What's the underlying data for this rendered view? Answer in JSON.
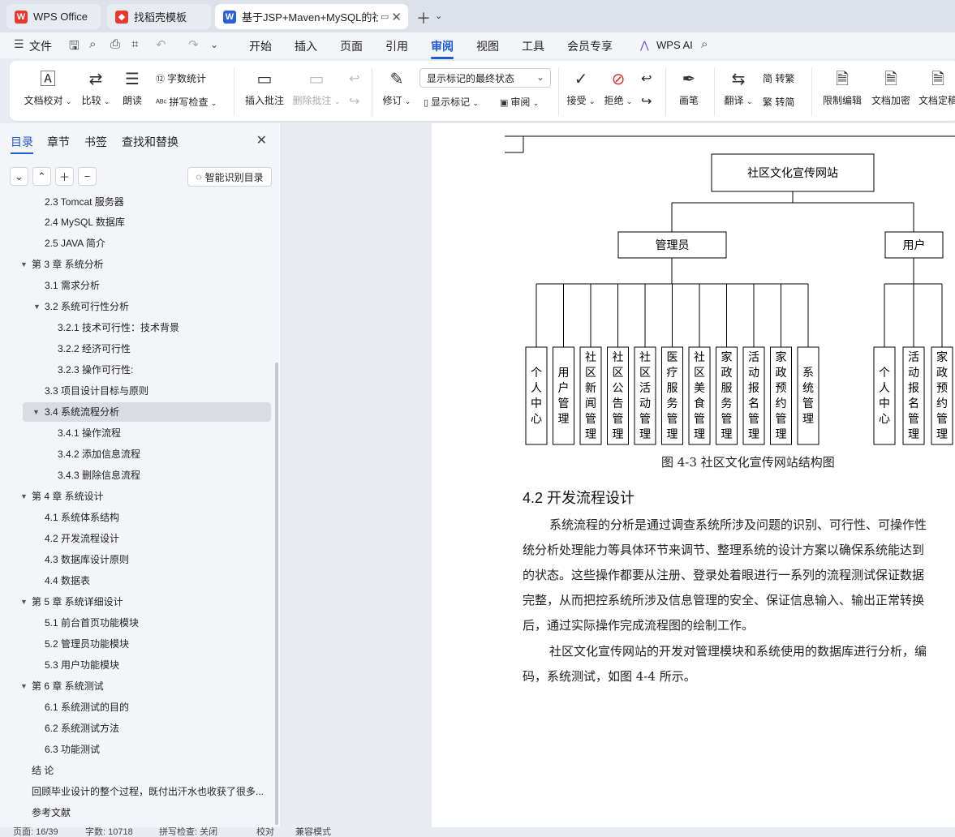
{
  "tabs": [
    {
      "label": "WPS Office",
      "icon": "wps-logo-icon",
      "color": "#e8392f"
    },
    {
      "label": "找稻壳模板",
      "icon": "docer-icon",
      "color": "#e8392f"
    },
    {
      "label": "基于JSP+Maven+MySQL的社",
      "icon": "word-doc-icon",
      "color": "#2b5fd9"
    }
  ],
  "menu": {
    "file_label": "文件",
    "items": [
      "开始",
      "插入",
      "页面",
      "引用",
      "审阅",
      "视图",
      "工具",
      "会员专享"
    ],
    "active": "审阅",
    "ai_label": "WPS AI"
  },
  "ribbon": {
    "doc_check": "文档校对",
    "compare": "比较",
    "read_aloud": "朗读",
    "word_count": "字数统计",
    "spell_check": "拼写检查",
    "insert_comment": "插入批注",
    "delete_comment": "删除批注",
    "revise": "修订",
    "show_markup": "显示标记",
    "review_pane": "审阅",
    "markup_state": "显示标记的最终状态",
    "accept": "接受",
    "reject": "拒绝",
    "pen": "画笔",
    "translate": "翻译",
    "to_traditional": "简 转繁",
    "to_simplified": "繁 转简",
    "restrict_edit": "限制编辑",
    "encrypt": "文档加密",
    "finalize": "文档定稿"
  },
  "sidebar": {
    "tabs": [
      "目录",
      "章节",
      "书签",
      "查找和替换"
    ],
    "smart_toc": "智能识别目录",
    "toc": [
      {
        "label": "2.3 Tomcat 服务器"
      },
      {
        "label": "2.4 MySQL 数据库"
      },
      {
        "label": "2.5 JAVA 简介"
      },
      {
        "label": "第 3 章  系统分析"
      },
      {
        "label": "3.1  需求分析"
      },
      {
        "label": "3.2  系统可行性分析"
      },
      {
        "label": "3.2.1 技术可行性：技术背景"
      },
      {
        "label": "3.2.2 经济可行性"
      },
      {
        "label": "3.2.3 操作可行性:"
      },
      {
        "label": "3.3  项目设计目标与原则"
      },
      {
        "label": "3.4 系统流程分析"
      },
      {
        "label": "3.4.1 操作流程"
      },
      {
        "label": "3.4.2 添加信息流程"
      },
      {
        "label": "3.4.3 删除信息流程"
      },
      {
        "label": "第 4 章  系统设计"
      },
      {
        "label": "4.1  系统体系结构"
      },
      {
        "label": "4.2 开发流程设计"
      },
      {
        "label": "4.3  数据库设计原则"
      },
      {
        "label": "4.4  数据表"
      },
      {
        "label": "第 5 章  系统详细设计"
      },
      {
        "label": "5.1 前台首页功能模块"
      },
      {
        "label": "5.2 管理员功能模块"
      },
      {
        "label": "5.3 用户功能模块"
      },
      {
        "label": "第 6 章   系统测试"
      },
      {
        "label": "6.1 系统测试的目的"
      },
      {
        "label": "6.2 系统测试方法"
      },
      {
        "label": "6.3 功能测试"
      },
      {
        "label": "结  论"
      },
      {
        "label": "回顾毕业设计的整个过程，既付出汗水也收获了很多..."
      },
      {
        "label": "参考文献"
      }
    ],
    "selected": "3.4 系统流程分析"
  },
  "document": {
    "diagram": {
      "root": "社区文化宣传网站",
      "admin": "管理员",
      "user": "用户",
      "admin_modules": [
        "个人中心",
        "用户管理",
        "社区新闻管理",
        "社区公告管理",
        "社区活动管理",
        "医疗服务管理",
        "社区美食管理",
        "家政服务管理",
        "活动报名管理",
        "家政预约管理",
        "系统管理"
      ],
      "user_modules": [
        "个人中心",
        "活动报名管理",
        "家政预约管理"
      ]
    },
    "caption": "图 4-3  社区文化宣传网站结构图",
    "heading": "4.2 开发流程设计",
    "paragraphs": [
      "系统流程的分析是通过调查系统所涉及问题的识别、可行性、可操作性",
      "统分析处理能力等具体环节来调节、整理系统的设计方案以确保系统能达到",
      "的状态。这些操作都要从注册、登录处着眼进行一系列的流程测试保证数据",
      "完整，从而把控系统所涉及信息管理的安全、保证信息输入、输出正常转换",
      "后，通过实际操作完成流程图的绘制工作。",
      "社区文化宣传网站的开发对管理模块和系统使用的数据库进行分析，编",
      "码，系统测试，如图 4-4 所示。"
    ]
  },
  "status": {
    "page": "页面: 16/39",
    "words": "字数: 10718",
    "spell": "拼写检查: 关闭",
    "proof": "校对",
    "compat": "兼容模式"
  }
}
